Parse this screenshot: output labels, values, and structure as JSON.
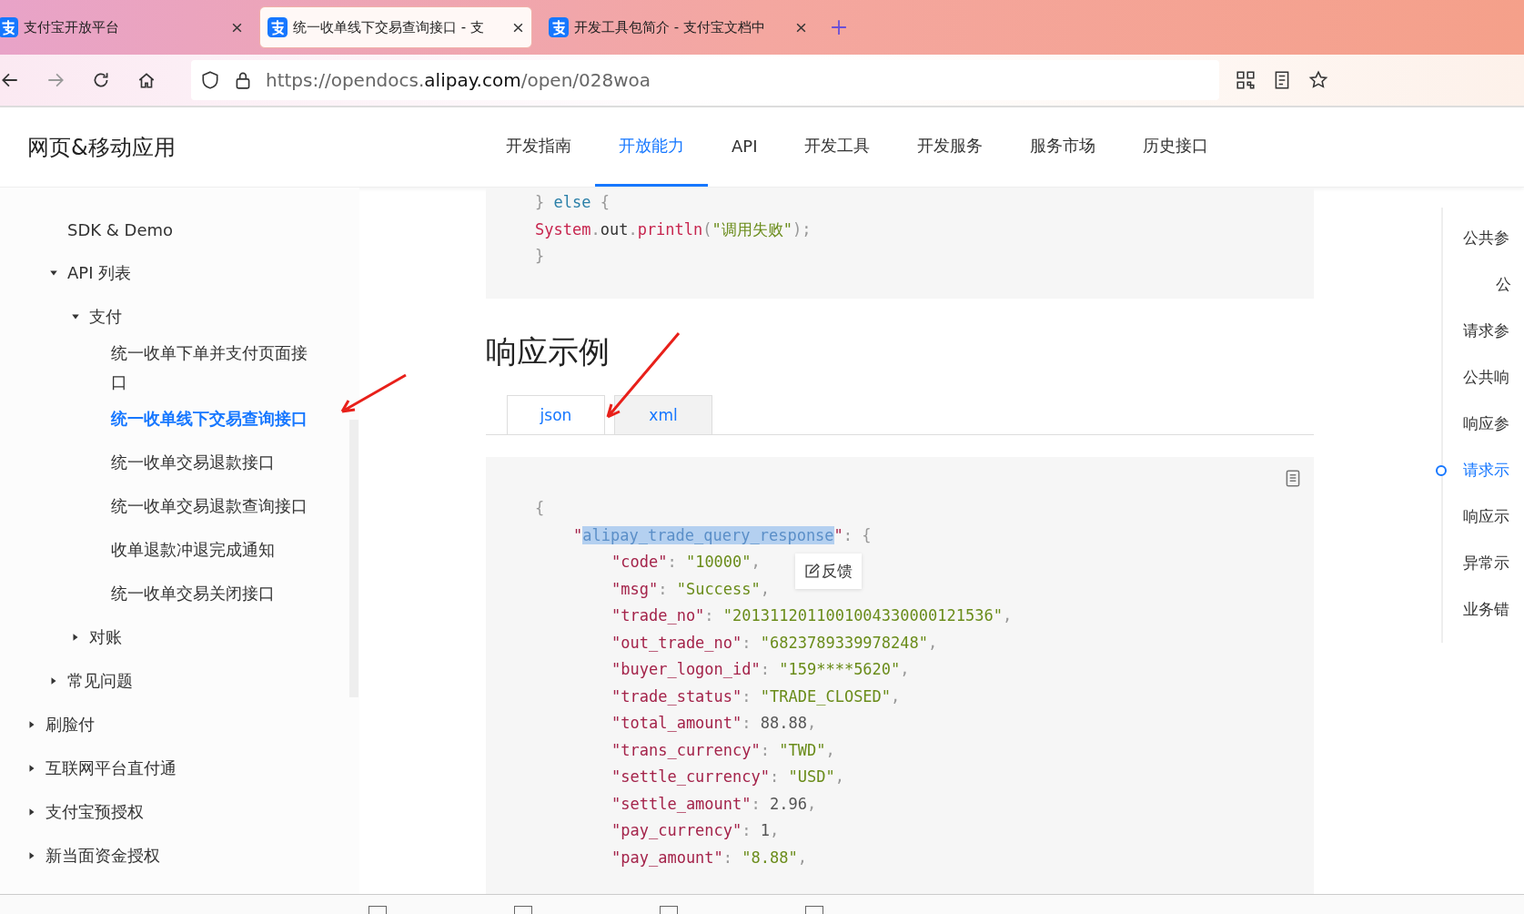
{
  "browser": {
    "tabs": [
      {
        "title": "支付宝开放平台",
        "selected": false
      },
      {
        "title": "统一收单线下交易查询接口 - 支",
        "selected": true
      },
      {
        "title": "开发工具包简介 - 支付宝文档中",
        "selected": false
      }
    ],
    "url": "https://opendocs.**alipay.com**/open/028woa"
  },
  "site": {
    "title": "网页&移动应用",
    "nav": [
      {
        "label": "开发指南",
        "selected": false
      },
      {
        "label": "开放能力",
        "selected": true
      },
      {
        "label": "API",
        "selected": false
      },
      {
        "label": "开发工具",
        "selected": false
      },
      {
        "label": "开发服务",
        "selected": false
      },
      {
        "label": "服务市场",
        "selected": false
      },
      {
        "label": "历史接口",
        "selected": false
      }
    ]
  },
  "sidebar": {
    "items": [
      {
        "children": [
          {
            "label": "SDK & Demo"
          },
          {
            "label": "API 列表",
            "expanded": true,
            "children": [
              {
                "label": "支付",
                "expanded": true,
                "children": [
                  {
                    "label": "统一收单下单并支付页面接口",
                    "selected": false
                  },
                  {
                    "label": "统一收单线下交易查询接口",
                    "selected": true
                  },
                  {
                    "label": "统一收单交易退款接口",
                    "selected": false
                  },
                  {
                    "label": "统一收单交易退款查询接口",
                    "selected": false
                  },
                  {
                    "label": "收单退款冲退完成通知",
                    "selected": false
                  },
                  {
                    "label": "统一收单交易关闭接口",
                    "selected": false
                  }
                ]
              },
              {
                "label": "对账",
                "expanded": false
              }
            ]
          },
          {
            "label": "常见问题",
            "expanded": false
          }
        ]
      },
      {
        "label": "刷脸付",
        "expanded": false
      },
      {
        "label": "互联网平台直付通",
        "expanded": false
      },
      {
        "label": "支付宝预授权",
        "expanded": false
      },
      {
        "label": "新当面资金授权",
        "expanded": false
      }
    ]
  },
  "request_code": {
    "lines": [
      {
        "tokens": [
          {
            "kind": "punct",
            "text": "} "
          },
          {
            "kind": "keyword",
            "text": "else"
          },
          {
            "kind": "punct",
            "text": " {"
          }
        ]
      },
      {
        "tokens": [
          {
            "kind": "class",
            "text": "System"
          },
          {
            "kind": "punct",
            "text": "."
          },
          {
            "kind": "plain",
            "text": "out"
          },
          {
            "kind": "punct",
            "text": "."
          },
          {
            "kind": "class",
            "text": "println"
          },
          {
            "kind": "punct",
            "text": "("
          },
          {
            "kind": "string",
            "text": "\"调用失败\""
          },
          {
            "kind": "punct",
            "text": ");"
          }
        ]
      },
      {
        "tokens": [
          {
            "kind": "punct",
            "text": "}"
          }
        ]
      }
    ]
  },
  "response": {
    "heading": "响应示例",
    "tabs": [
      {
        "label": "json",
        "selected": true
      },
      {
        "label": "xml",
        "selected": false
      }
    ],
    "feedback": "反馈",
    "lines": [
      {
        "tokens": [
          {
            "kind": "punct",
            "text": "{"
          }
        ],
        "children": [
          {
            "tokens": [
              {
                "kind": "key",
                "text": "\""
              },
              {
                "kind": "selected",
                "text": "alipay_trade_query_response"
              },
              {
                "kind": "key",
                "text": "\""
              },
              {
                "kind": "punct",
                "text": ": {"
              }
            ],
            "children": [
              {
                "tokens": [
                  {
                    "kind": "key",
                    "text": "\"code\""
                  },
                  {
                    "kind": "punct",
                    "text": ": "
                  },
                  {
                    "kind": "string",
                    "text": "\"10000\""
                  },
                  {
                    "kind": "punct",
                    "text": ","
                  }
                ]
              },
              {
                "tokens": [
                  {
                    "kind": "key",
                    "text": "\"msg\""
                  },
                  {
                    "kind": "punct",
                    "text": ": "
                  },
                  {
                    "kind": "string",
                    "text": "\"Success\""
                  },
                  {
                    "kind": "punct",
                    "text": ","
                  }
                ]
              },
              {
                "tokens": [
                  {
                    "kind": "key",
                    "text": "\"trade_no\""
                  },
                  {
                    "kind": "punct",
                    "text": ": "
                  },
                  {
                    "kind": "string",
                    "text": "\"2013112011001004330000121536\""
                  },
                  {
                    "kind": "punct",
                    "text": ","
                  }
                ]
              },
              {
                "tokens": [
                  {
                    "kind": "key",
                    "text": "\"out_trade_no\""
                  },
                  {
                    "kind": "punct",
                    "text": ": "
                  },
                  {
                    "kind": "string",
                    "text": "\"6823789339978248\""
                  },
                  {
                    "kind": "punct",
                    "text": ","
                  }
                ]
              },
              {
                "tokens": [
                  {
                    "kind": "key",
                    "text": "\"buyer_logon_id\""
                  },
                  {
                    "kind": "punct",
                    "text": ": "
                  },
                  {
                    "kind": "string",
                    "text": "\"159****5620\""
                  },
                  {
                    "kind": "punct",
                    "text": ","
                  }
                ]
              },
              {
                "tokens": [
                  {
                    "kind": "key",
                    "text": "\"trade_status\""
                  },
                  {
                    "kind": "punct",
                    "text": ": "
                  },
                  {
                    "kind": "string",
                    "text": "\"TRADE_CLOSED\""
                  },
                  {
                    "kind": "punct",
                    "text": ","
                  }
                ]
              },
              {
                "tokens": [
                  {
                    "kind": "key",
                    "text": "\"total_amount\""
                  },
                  {
                    "kind": "punct",
                    "text": ": "
                  },
                  {
                    "kind": "number",
                    "text": "88.88"
                  },
                  {
                    "kind": "punct",
                    "text": ","
                  }
                ]
              },
              {
                "tokens": [
                  {
                    "kind": "key",
                    "text": "\"trans_currency\""
                  },
                  {
                    "kind": "punct",
                    "text": ": "
                  },
                  {
                    "kind": "string",
                    "text": "\"TWD\""
                  },
                  {
                    "kind": "punct",
                    "text": ","
                  }
                ]
              },
              {
                "tokens": [
                  {
                    "kind": "key",
                    "text": "\"settle_currency\""
                  },
                  {
                    "kind": "punct",
                    "text": ": "
                  },
                  {
                    "kind": "string",
                    "text": "\"USD\""
                  },
                  {
                    "kind": "punct",
                    "text": ","
                  }
                ]
              },
              {
                "tokens": [
                  {
                    "kind": "key",
                    "text": "\"settle_amount\""
                  },
                  {
                    "kind": "punct",
                    "text": ": "
                  },
                  {
                    "kind": "number",
                    "text": "2.96"
                  },
                  {
                    "kind": "punct",
                    "text": ","
                  }
                ]
              },
              {
                "tokens": [
                  {
                    "kind": "key",
                    "text": "\"pay_currency\""
                  },
                  {
                    "kind": "punct",
                    "text": ": "
                  },
                  {
                    "kind": "number",
                    "text": "1"
                  },
                  {
                    "kind": "punct",
                    "text": ","
                  }
                ]
              },
              {
                "tokens": [
                  {
                    "kind": "key",
                    "text": "\"pay_amount\""
                  },
                  {
                    "kind": "punct",
                    "text": ": "
                  },
                  {
                    "kind": "string",
                    "text": "\"8.88\""
                  },
                  {
                    "kind": "punct",
                    "text": ","
                  }
                ]
              }
            ]
          }
        ]
      }
    ]
  },
  "toc": {
    "items": [
      {
        "label": "公共参",
        "selected": false,
        "children": [
          {
            "label": "公",
            "selected": false
          }
        ]
      },
      {
        "label": "请求参",
        "selected": false
      },
      {
        "label": "公共响",
        "selected": false
      },
      {
        "label": "响应参",
        "selected": false
      },
      {
        "label": "请求示",
        "selected": true
      },
      {
        "label": "响应示",
        "selected": false
      },
      {
        "label": "异常示",
        "selected": false
      },
      {
        "label": "业务错",
        "selected": false
      }
    ]
  }
}
